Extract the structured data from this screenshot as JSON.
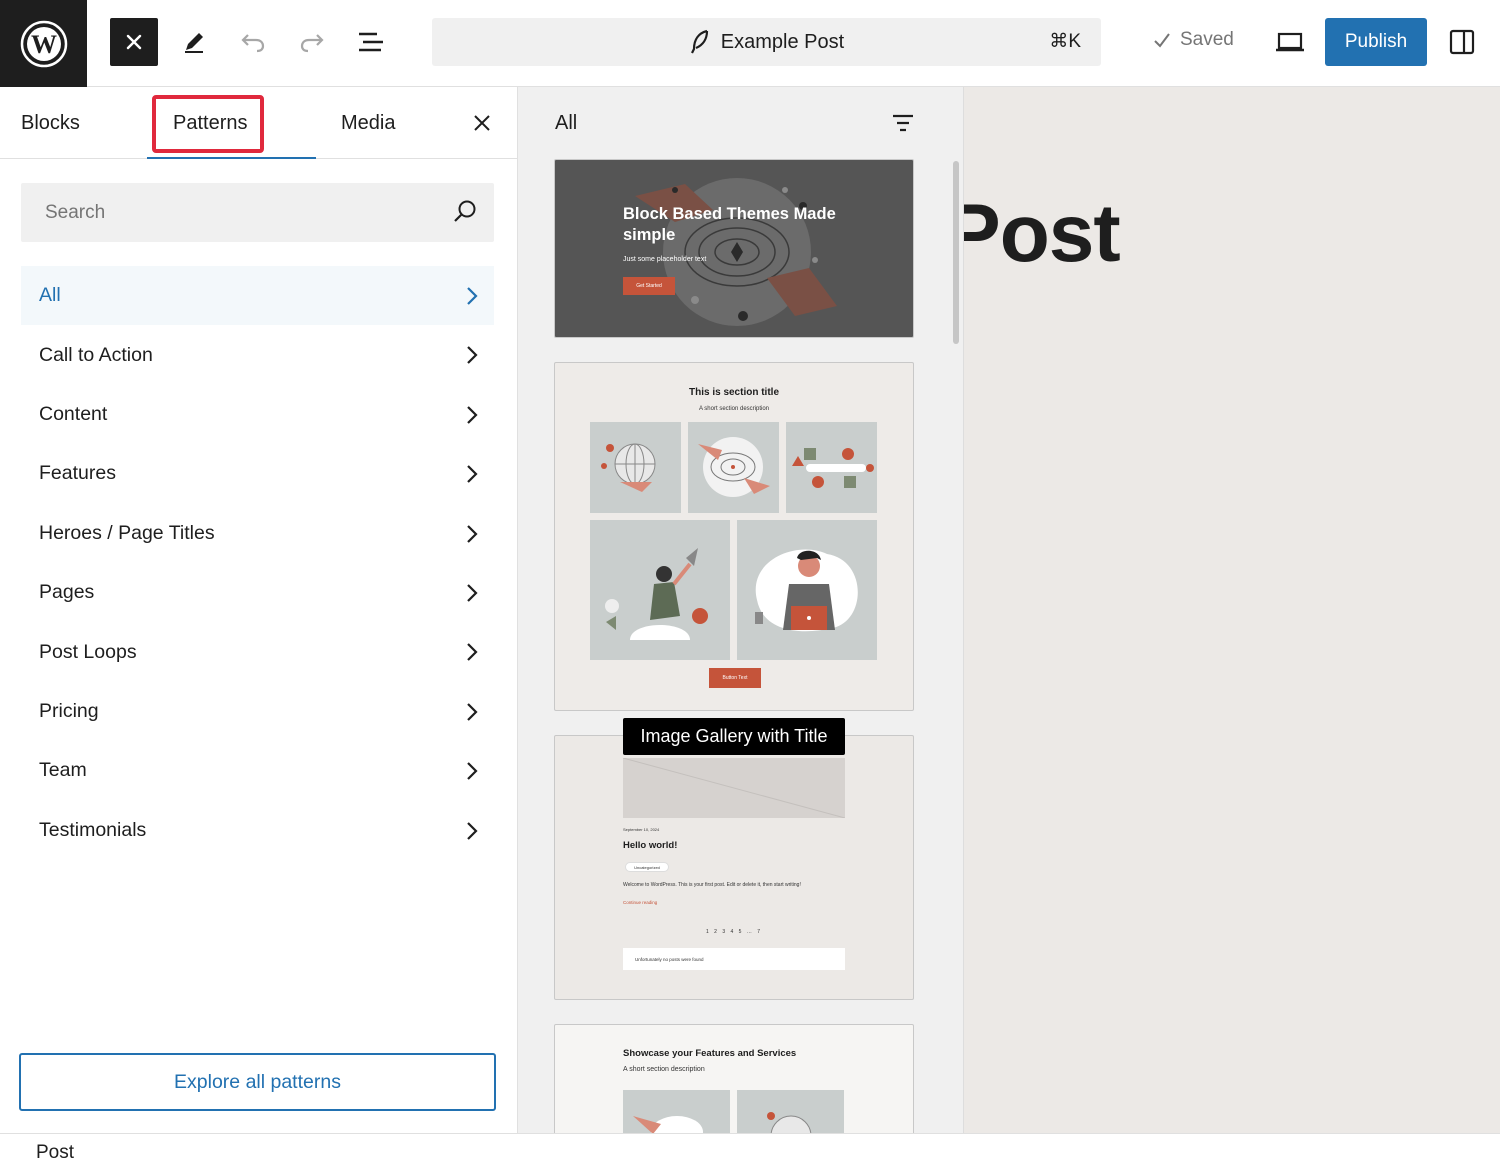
{
  "toolbar": {
    "document_title": "Example Post",
    "shortcut": "⌘K",
    "saved_label": "Saved",
    "publish_label": "Publish"
  },
  "inserter": {
    "tabs": [
      {
        "label": "Blocks"
      },
      {
        "label": "Patterns",
        "selected": true
      },
      {
        "label": "Media"
      }
    ],
    "search_placeholder": "Search",
    "categories": [
      {
        "label": "All",
        "selected": true
      },
      {
        "label": "Call to Action"
      },
      {
        "label": "Content"
      },
      {
        "label": "Features"
      },
      {
        "label": "Heroes / Page Titles"
      },
      {
        "label": "Pages"
      },
      {
        "label": "Post Loops"
      },
      {
        "label": "Pricing"
      },
      {
        "label": "Team"
      },
      {
        "label": "Testimonials"
      }
    ],
    "explore_label": "Explore all patterns"
  },
  "patterns": {
    "header": "All",
    "card1": {
      "title": "Block Based Themes Made simple",
      "subtitle": "Just some placeholder text",
      "button": "Get Started"
    },
    "card2": {
      "title": "This is section title",
      "subtitle": "A short section description",
      "button": "Button Text"
    },
    "tooltip": "Image Gallery with Title",
    "card3": {
      "date": "September 10, 2024",
      "heading": "Hello world!",
      "tag": "Uncategorized",
      "body": "Welcome to WordPress. This is your first post. Edit or delete it, then start writing!",
      "more": "Continue reading",
      "pagination": "1 2 3 4 5 … 7",
      "empty": "Unfortunately no posts were found"
    },
    "card4": {
      "title": "Showcase your Features and Services",
      "subtitle": "A short section description"
    }
  },
  "canvas": {
    "title_fragment": "Post"
  },
  "footer": {
    "breadcrumb": "Post"
  },
  "colors": {
    "accent": "#2271b1",
    "highlight": "#e0293d",
    "brand_dark": "#1e1e1e",
    "pattern_accent": "#c5543a"
  }
}
